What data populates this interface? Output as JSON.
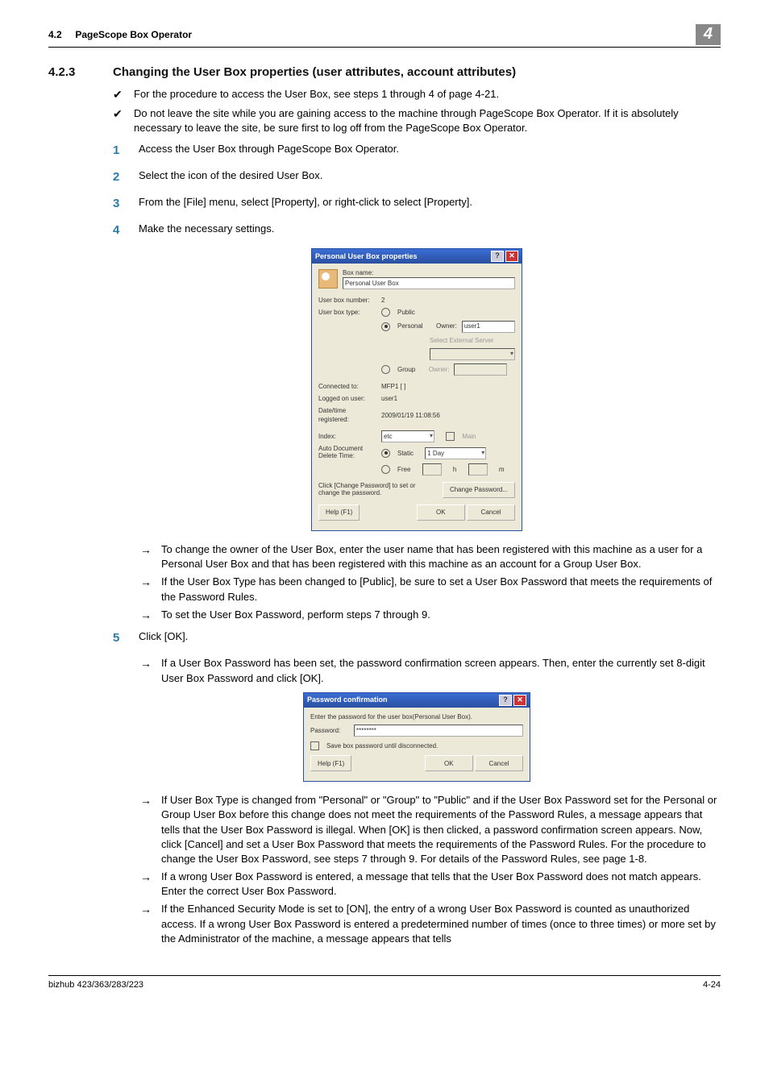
{
  "header": {
    "section_no": "4.2",
    "section_name": "PageScope Box Operator",
    "chapter_no": "4"
  },
  "section": {
    "number": "4.2.3",
    "title": "Changing the User Box properties (user attributes, account attributes)"
  },
  "checks": [
    "For the procedure to access the User Box, see steps 1 through 4 of page 4-21.",
    "Do not leave the site while you are gaining access to the machine through PageScope Box Operator. If it is absolutely necessary to leave the site, be sure first to log off from the PageScope Box Operator."
  ],
  "steps": [
    {
      "n": "1",
      "t": "Access the User Box through PageScope Box Operator."
    },
    {
      "n": "2",
      "t": "Select the icon of the desired User Box."
    },
    {
      "n": "3",
      "t": "From the [File] menu, select [Property], or right-click to select [Property]."
    },
    {
      "n": "4",
      "t": "Make the necessary settings."
    }
  ],
  "dialog_props": {
    "title": "Personal User Box properties",
    "boxname_label": "Box name:",
    "boxname_value": "Personal User Box",
    "userboxno_label": "User box number:",
    "userboxno_value": "2",
    "userboxtype_label": "User box type:",
    "type_public": "Public",
    "type_personal": "Personal",
    "owner_label": "Owner:",
    "owner_value": "user1",
    "ext_server_label": "Select External Server",
    "type_group": "Group",
    "group_owner_label": "Owner:",
    "connected_label": "Connected to:",
    "connected_value": "MFP1 [             ]",
    "logged_label": "Logged on user:",
    "logged_value": "user1",
    "datetime_label": "Date/time registered:",
    "datetime_value": "2009/01/19 11:08:56",
    "index_label": "Index:",
    "index_value": "etc",
    "main_cb": "Main",
    "autodel_label": "Auto Document Delete Time:",
    "static_label": "Static",
    "static_value": "1 Day",
    "free_label": "Free",
    "h_unit": "h",
    "m_unit": "m",
    "pw_hint": "Click [Change Password] to set or change the password.",
    "change_pw_btn": "Change Password...",
    "help_btn": "Help (F1)",
    "ok_btn": "OK",
    "cancel_btn": "Cancel"
  },
  "step4_notes": [
    "To change the owner of the User Box, enter the user name that has been registered with this machine as a user for a Personal User Box and that has been registered with this machine as an account for a Group User Box.",
    "If the User Box Type has been changed to [Public], be sure to set a User Box Password that meets the requirements of the Password Rules.",
    "To set the User Box Password, perform steps 7 through 9."
  ],
  "step5": {
    "n": "5",
    "t": "Click [OK]."
  },
  "step5_notes_a": [
    "If a User Box Password has been set, the password confirmation screen appears. Then, enter the currently set 8-digit User Box Password and click [OK]."
  ],
  "dialog_pw": {
    "title": "Password confirmation",
    "instr": "Enter the password for the user box(Personal User Box).",
    "pw_label": "Password:",
    "pw_value": "********",
    "save_cb": "Save box password until disconnected.",
    "help_btn": "Help (F1)",
    "ok_btn": "OK",
    "cancel_btn": "Cancel"
  },
  "step5_notes_b": [
    "If User Box Type is changed from \"Personal\" or \"Group\" to \"Public\" and if the User Box Password set for the Personal or Group User Box before this change does not meet the requirements of the Password Rules, a message appears that tells that the User Box Password is illegal. When [OK] is then clicked, a password confirmation screen appears. Now, click [Cancel] and set a User Box Password that meets the requirements of the Password Rules. For the procedure to change the User Box Password, see steps 7 through 9. For details of the Password Rules, see page 1-8.",
    "If a wrong User Box Password is entered, a message that tells that the User Box Password does not match appears. Enter the correct User Box Password.",
    "If the Enhanced Security Mode is set to [ON], the entry of a wrong User Box Password is counted as unauthorized access. If a wrong User Box Password is entered a predetermined number of times (once to three times) or more set by the Administrator of the machine, a message appears that tells"
  ],
  "footer": {
    "left": "bizhub 423/363/283/223",
    "right": "4-24"
  }
}
